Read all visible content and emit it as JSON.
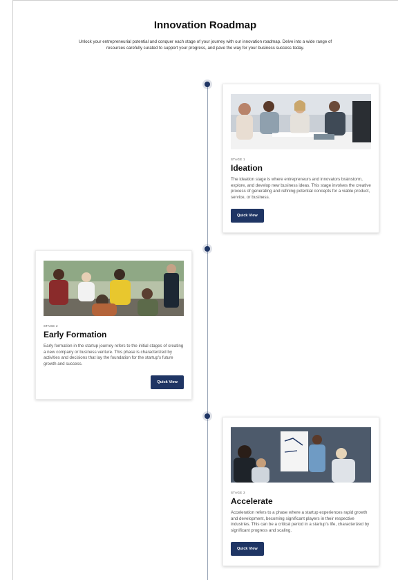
{
  "header": {
    "title": "Innovation Roadmap",
    "subtitle": "Unlock your entrepreneurial potential and conquer each stage of your journey with our innovation roadmap. Delve into a wide range of resources carefully curated to support your progress, and pave the way for your business success today."
  },
  "stages": [
    {
      "stage_label": "STAGE 1",
      "title": "Ideation",
      "description": "The ideation stage is where entrepreneurs and innovators brainstorm, explore, and develop new business ideas. This stage involves the creative process of generating and refining potential concepts for a viable product, service, or business.",
      "button": "Quick View"
    },
    {
      "stage_label": "STAGE 2",
      "title": "Early Formation",
      "description": "Early formation in the startup journey refers to the initial stages of creating a new company or business venture. This phase is characterized by activities and decisions that lay the foundation for the startup's future growth and success.",
      "button": "Quick View"
    },
    {
      "stage_label": "STAGE 3",
      "title": "Accelerate",
      "description": "Acceleration refers to a phase where a startup experiences rapid growth and development, becoming significant players in their respective industries. This can be a critical period in a startup's life, characterized by significant progress and scaling.",
      "button": "Quick View"
    }
  ],
  "colors": {
    "accent": "#1f3564",
    "timeline": "#9aa6b8"
  }
}
